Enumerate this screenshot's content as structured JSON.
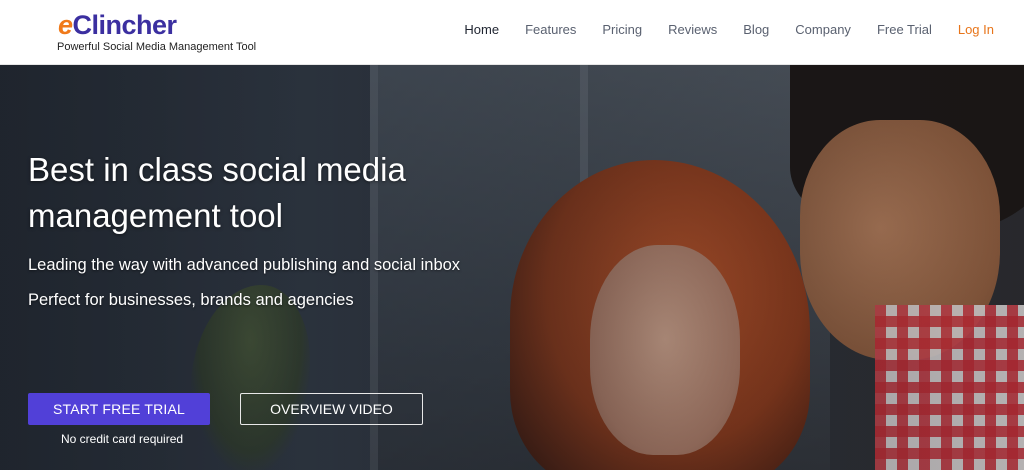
{
  "header": {
    "logo_e": "e",
    "logo_rest": "Clincher",
    "tagline": "Powerful Social Media Management Tool",
    "nav": [
      "Home",
      "Features",
      "Pricing",
      "Reviews",
      "Blog",
      "Company",
      "Free Trial",
      "Log In"
    ],
    "active_nav": "Home"
  },
  "hero": {
    "title": "Best in class social media management tool",
    "subtitle_1": "Leading the way with advanced publishing and social inbox",
    "subtitle_2": "Perfect for businesses, brands and agencies",
    "primary_button": "START FREE TRIAL",
    "secondary_button": "OVERVIEW VIDEO",
    "note": "No credit card required"
  },
  "colors": {
    "brand_purple": "#3b2fa0",
    "brand_orange": "#f07a1a",
    "button_purple": "#5140d8",
    "login_orange": "#e8751a"
  }
}
